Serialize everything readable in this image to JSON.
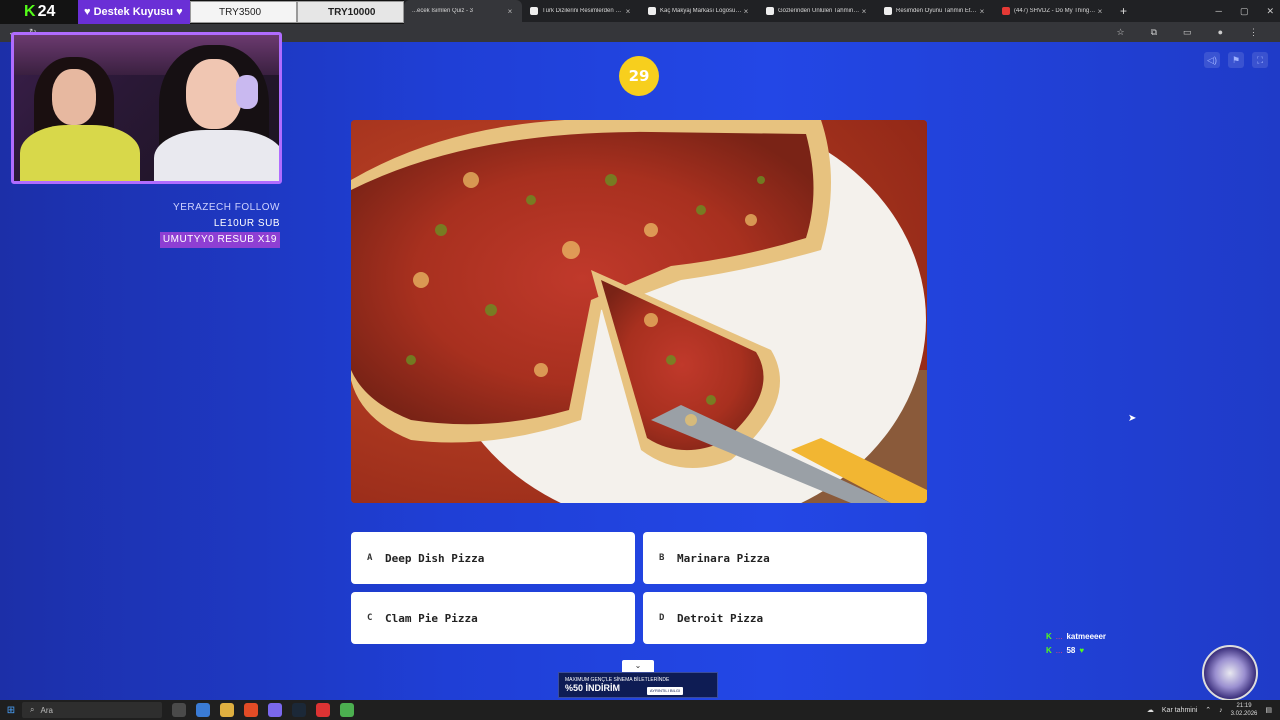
{
  "browser": {
    "tabs": [
      {
        "title": "...ecek İsimleri Quiz - 3",
        "active": true
      },
      {
        "title": "Türk Dizilerini Resimlerden Tahm",
        "active": false
      },
      {
        "title": "Kaç Makyaj Markası Logosu Bil",
        "active": false
      },
      {
        "title": "Gözlerinden Ünlüleri Tahmin Et",
        "active": false
      },
      {
        "title": "Resimden Oyunu Tahmin Et - 1",
        "active": false
      },
      {
        "title": "(447) SHVDZ - Do My Thing [Tr",
        "active": false
      }
    ],
    "new_tab": "+"
  },
  "overlay": {
    "brand_text": "24",
    "destek_label": "♥ Destek Kuyusu ♥",
    "goal_1": "TRY3500",
    "goal_2": "TRY10000"
  },
  "events": [
    {
      "text": "YERAZECH  FOLLOW"
    },
    {
      "text": "LE10UR  SUB"
    },
    {
      "text": "UMUTYY0  RESUB X19"
    }
  ],
  "quiz": {
    "timer": "29",
    "image_alt": "deep dish pizza photo",
    "answers": [
      {
        "letter": "A",
        "text": "Deep Dish Pizza"
      },
      {
        "letter": "B",
        "text": "Marinara Pizza"
      },
      {
        "letter": "C",
        "text": "Clam Pie Pizza"
      },
      {
        "letter": "D",
        "text": "Detroit Pizza"
      }
    ]
  },
  "ad": {
    "line1": "MAXIMUM GENÇ'LE SİNEMA BİLETLERİNDE",
    "line2": "%50 İNDİRİM",
    "button": "AYRINTILI BILGI"
  },
  "chat": [
    {
      "user": "...",
      "message": "katmeeeer"
    },
    {
      "user": "...",
      "message": "58"
    }
  ],
  "taskbar": {
    "search_placeholder": "Ara",
    "weather": "Kar tahmini",
    "time": "21:19",
    "date": "3.02.2026"
  }
}
